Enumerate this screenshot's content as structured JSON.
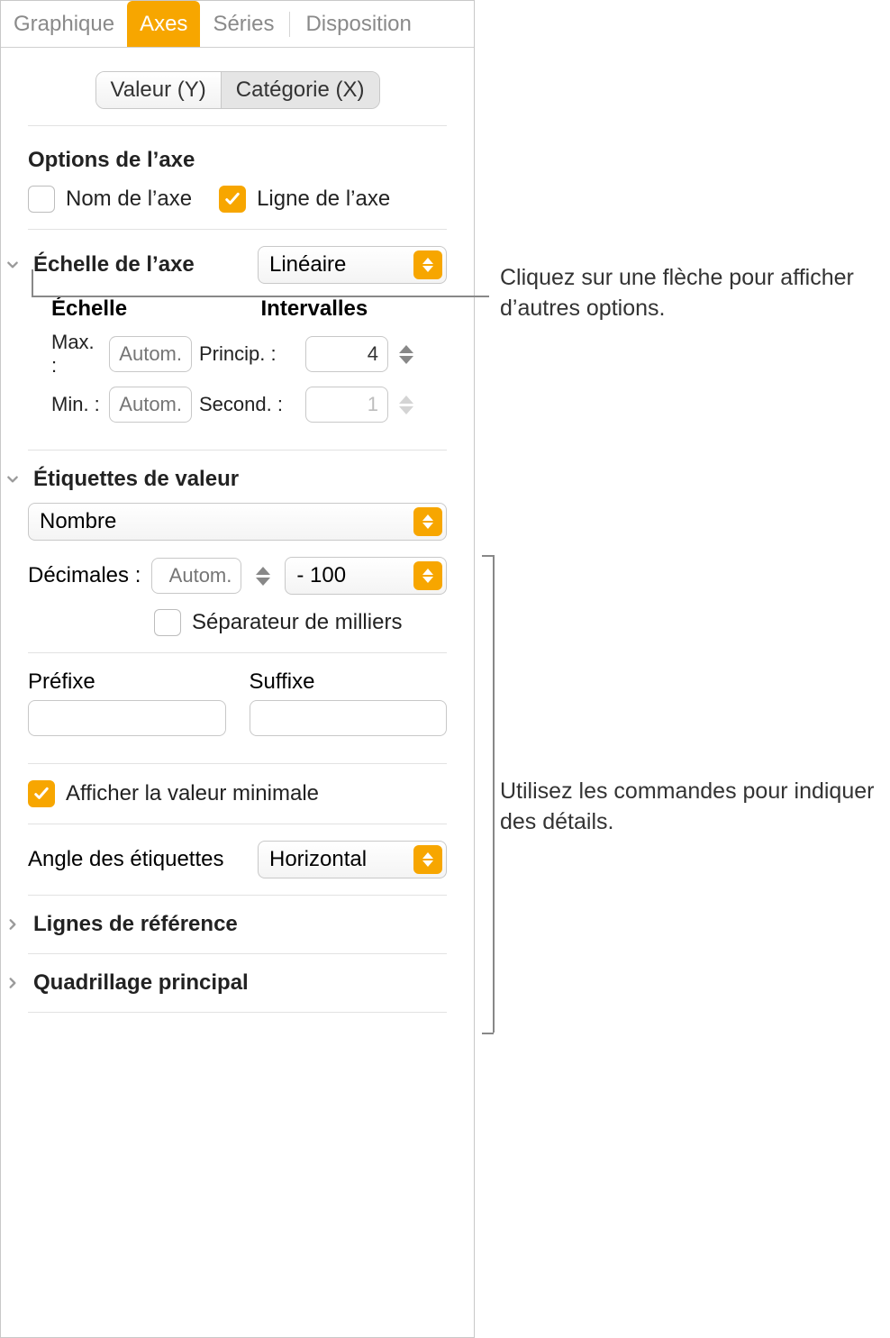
{
  "tabs": {
    "graphique": "Graphique",
    "axes": "Axes",
    "series": "Séries",
    "disposition": "Disposition"
  },
  "axis_selector": {
    "value_y": "Valeur (Y)",
    "category_x": "Catégorie (X)"
  },
  "axis_options": {
    "title": "Options de l’axe",
    "axis_name_label": "Nom de l’axe",
    "axis_line_label": "Ligne de l’axe"
  },
  "axis_scale": {
    "title": "Échelle de l’axe",
    "type_value": "Linéaire",
    "scale_heading": "Échelle",
    "intervals_heading": "Intervalles",
    "max_label": "Max. :",
    "min_label": "Min. :",
    "max_placeholder": "Autom.",
    "min_placeholder": "Autom.",
    "major_label": "Princip. :",
    "minor_label": "Second. :",
    "major_value": "4",
    "minor_value": "1"
  },
  "value_labels": {
    "title": "Étiquettes de valeur",
    "format_value": "Nombre",
    "decimals_label": "Décimales :",
    "decimals_placeholder": "Autom.",
    "negative_format_value": "- 100",
    "thousands_label": "Séparateur de milliers",
    "prefix_label": "Préfixe",
    "suffix_label": "Suffixe"
  },
  "show_min": {
    "label": "Afficher la valeur minimale"
  },
  "label_angle": {
    "label": "Angle des étiquettes",
    "value": "Horizontal"
  },
  "reference_lines": {
    "title": "Lignes de référence"
  },
  "major_grid": {
    "title": "Quadrillage principal"
  },
  "callouts": {
    "top": "Cliquez sur une flèche pour afficher d’autres options.",
    "bottom": "Utilisez les commandes pour indiquer des détails."
  }
}
